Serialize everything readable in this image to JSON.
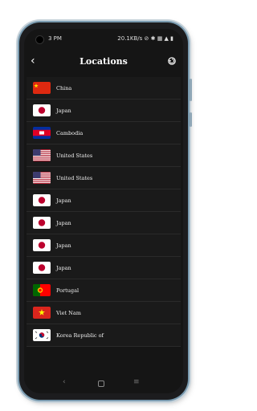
{
  "status": {
    "time": "3 PM",
    "network_speed": "20.1KB/s",
    "icons_right": "⊘ ✱ ▦ ▲ ▮"
  },
  "header": {
    "title": "Locations",
    "back_icon": "back-arrow-icon",
    "refresh_icon": "refresh-icon"
  },
  "locations": [
    {
      "name": "China",
      "flag": "china"
    },
    {
      "name": "Japan",
      "flag": "japan"
    },
    {
      "name": "Cambodia",
      "flag": "cambodia"
    },
    {
      "name": "United States",
      "flag": "usa"
    },
    {
      "name": "United States",
      "flag": "usa"
    },
    {
      "name": "Japan",
      "flag": "japan"
    },
    {
      "name": "Japan",
      "flag": "japan"
    },
    {
      "name": "Japan",
      "flag": "japan"
    },
    {
      "name": "Japan",
      "flag": "japan"
    },
    {
      "name": "Portugal",
      "flag": "portugal"
    },
    {
      "name": "Viet Nam",
      "flag": "vietnam"
    },
    {
      "name": "Korea Republic of",
      "flag": "korea"
    }
  ],
  "nav": {
    "back": "‹",
    "menu": "≡"
  }
}
